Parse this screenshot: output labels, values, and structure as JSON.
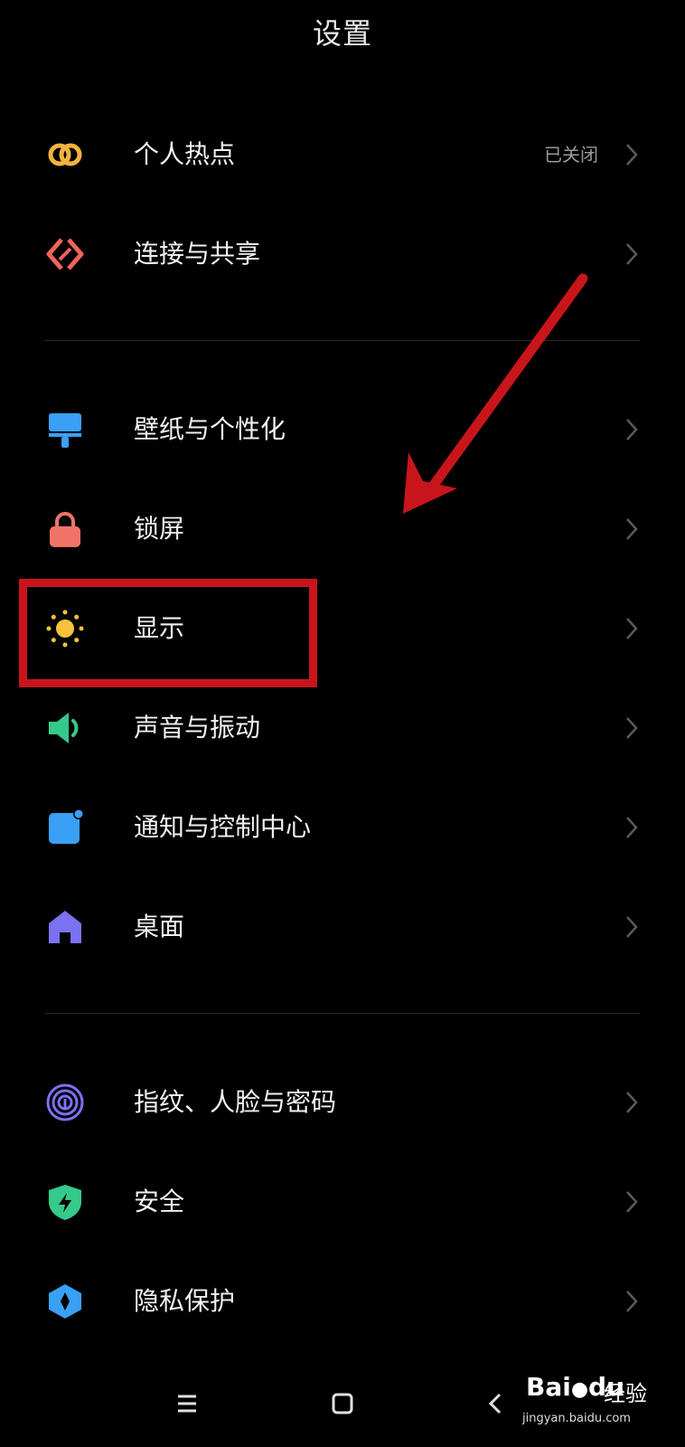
{
  "header": {
    "title": "设置"
  },
  "items": [
    {
      "label": "个人热点",
      "value": "已关闭",
      "icon": "hotspot-icon",
      "color": "#f2b33d"
    },
    {
      "label": "连接与共享",
      "value": "",
      "icon": "connection-share-icon",
      "color": "#f0645a"
    },
    {
      "label": "壁纸与个性化",
      "value": "",
      "icon": "wallpaper-icon",
      "color": "#3aa0f5"
    },
    {
      "label": "锁屏",
      "value": "",
      "icon": "lock-icon",
      "color": "#f07368"
    },
    {
      "label": "显示",
      "value": "",
      "icon": "sun-icon",
      "color": "#f7c23b"
    },
    {
      "label": "声音与振动",
      "value": "",
      "icon": "speaker-icon",
      "color": "#35c98b"
    },
    {
      "label": "通知与控制中心",
      "value": "",
      "icon": "notification-icon",
      "color": "#3aa0f5"
    },
    {
      "label": "桌面",
      "value": "",
      "icon": "home-icon",
      "color": "#7b72f2"
    },
    {
      "label": "指纹、人脸与密码",
      "value": "",
      "icon": "fingerprint-icon",
      "color": "#7b72f2"
    },
    {
      "label": "安全",
      "value": "",
      "icon": "shield-icon",
      "color": "#35c98b"
    },
    {
      "label": "隐私保护",
      "value": "",
      "icon": "privacy-icon",
      "color": "#3aa0f5"
    }
  ],
  "annotation": {
    "highlight_color": "#c8151b",
    "arrow_color": "#c8151b"
  },
  "watermark": {
    "brand": "Bai",
    "brand_paw": "du",
    "brand_suffix": "经验",
    "url": "jingyan.baidu.com"
  },
  "navbar": {
    "icons": [
      "menu-icon",
      "home-square-icon",
      "back-icon"
    ]
  }
}
